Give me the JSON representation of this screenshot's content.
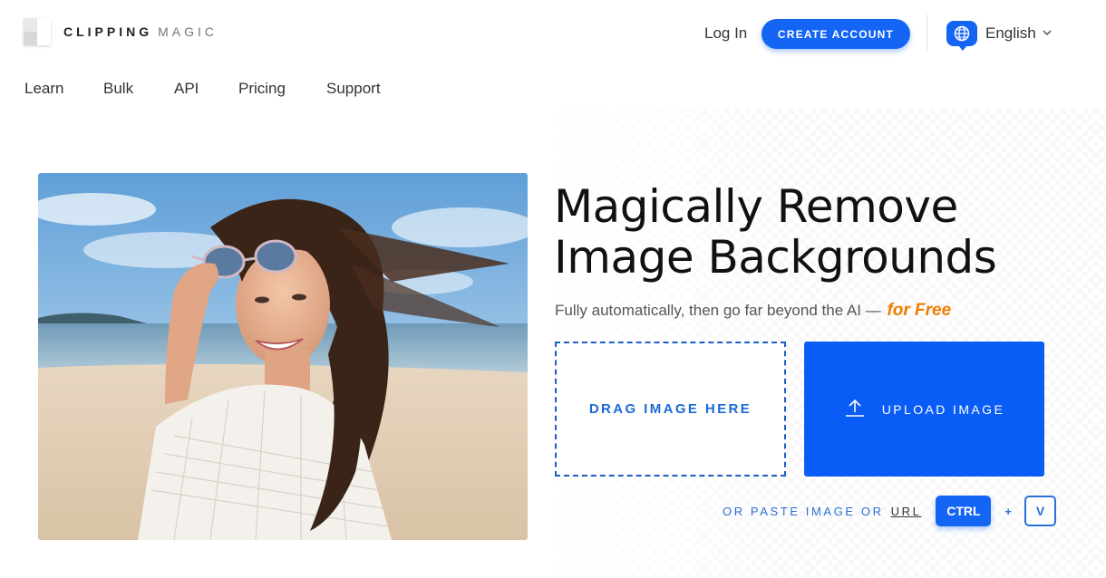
{
  "brand": {
    "name_bold": "CLIPPING",
    "name_light": "MAGIC"
  },
  "header": {
    "login_label": "Log In",
    "create_account_label": "CREATE ACCOUNT",
    "language_label": "English"
  },
  "nav": {
    "items": [
      {
        "label": "Learn"
      },
      {
        "label": "Bulk"
      },
      {
        "label": "API"
      },
      {
        "label": "Pricing"
      },
      {
        "label": "Support"
      }
    ]
  },
  "hero": {
    "headline_line1": "Magically Remove",
    "headline_line2": "Image Backgrounds",
    "subtitle": "Fully automatically, then go far beyond the AI —",
    "subtitle_highlight": "for Free",
    "drop_label": "DRAG IMAGE HERE",
    "upload_label": "UPLOAD IMAGE",
    "paste_text": "OR PASTE IMAGE OR",
    "paste_url_label": "URL",
    "ctrl_key": "CTRL",
    "plus": "+",
    "v_key": "V"
  },
  "icons": {
    "language": "globe-icon",
    "dropdown": "chevron-down-icon",
    "upload": "upload-arrow-icon"
  },
  "colors": {
    "accent_blue": "#1565f5",
    "upload_blue": "#0a5cf7",
    "highlight_orange": "#f07c00"
  }
}
